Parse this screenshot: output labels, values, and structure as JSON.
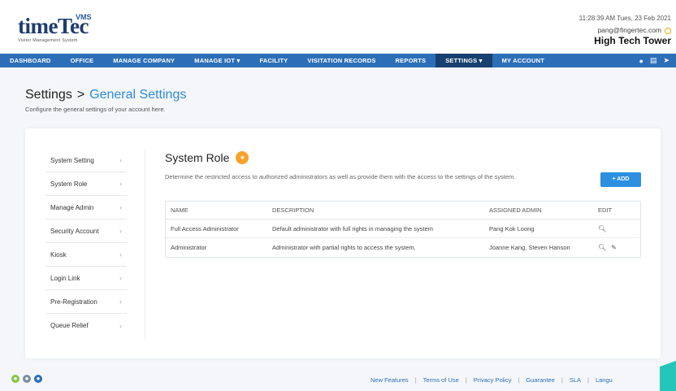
{
  "header": {
    "logo_main": "timeTec",
    "logo_vms": "VMS",
    "logo_sub": "Visitor Management System",
    "datetime": "11:28:39 AM  Tues, 23 Feb 2021",
    "email": "pang@fingertec.com",
    "building": "High Tech Tower"
  },
  "nav": {
    "items": [
      "DASHBOARD",
      "OFFICE",
      "MANAGE COMPANY",
      "MANAGE IOT ▾",
      "FACILITY",
      "VISITATION RECORDS",
      "REPORTS",
      "SETTINGS ▾",
      "MY ACCOUNT"
    ],
    "active": "SETTINGS ▾"
  },
  "page": {
    "title": "Settings",
    "separator": ">",
    "subtitle": "General Settings",
    "description": "Configure the general settings of your account here."
  },
  "sidebar": {
    "items": [
      "System Setting",
      "System Role",
      "Manage Admin",
      "Security Account",
      "Kiosk",
      "Login Link",
      "Pre-Registration",
      "Queue Relief"
    ]
  },
  "content": {
    "title": "System Role",
    "description": "Determine the restricted access to authorized administrators as well as provide them with the access to the settings of the system.",
    "add_label": "+ ADD",
    "columns": [
      "NAME",
      "DESCRIPTION",
      "ASSIGNED ADMIN",
      "EDIT"
    ],
    "rows": [
      {
        "name": "Full Access Administrator",
        "description": "Default administrator with full rights in managing the system",
        "admin": "Pang Kok Loong"
      },
      {
        "name": "Administrator",
        "description": "Administrator with partial rights to access the system.",
        "admin": "Joanne Kang, Steven Hanson"
      }
    ]
  },
  "footer": {
    "links": [
      "New Features",
      "Terms of Use",
      "Privacy Policy",
      "Guarantee",
      "SLA",
      "Langu"
    ]
  },
  "colors": {
    "nav": "#2c6fb8",
    "nav_active": "#17406e",
    "accent": "#2d8ad8",
    "add_button": "#2c8fe0",
    "bulb": "#f7a22b"
  }
}
